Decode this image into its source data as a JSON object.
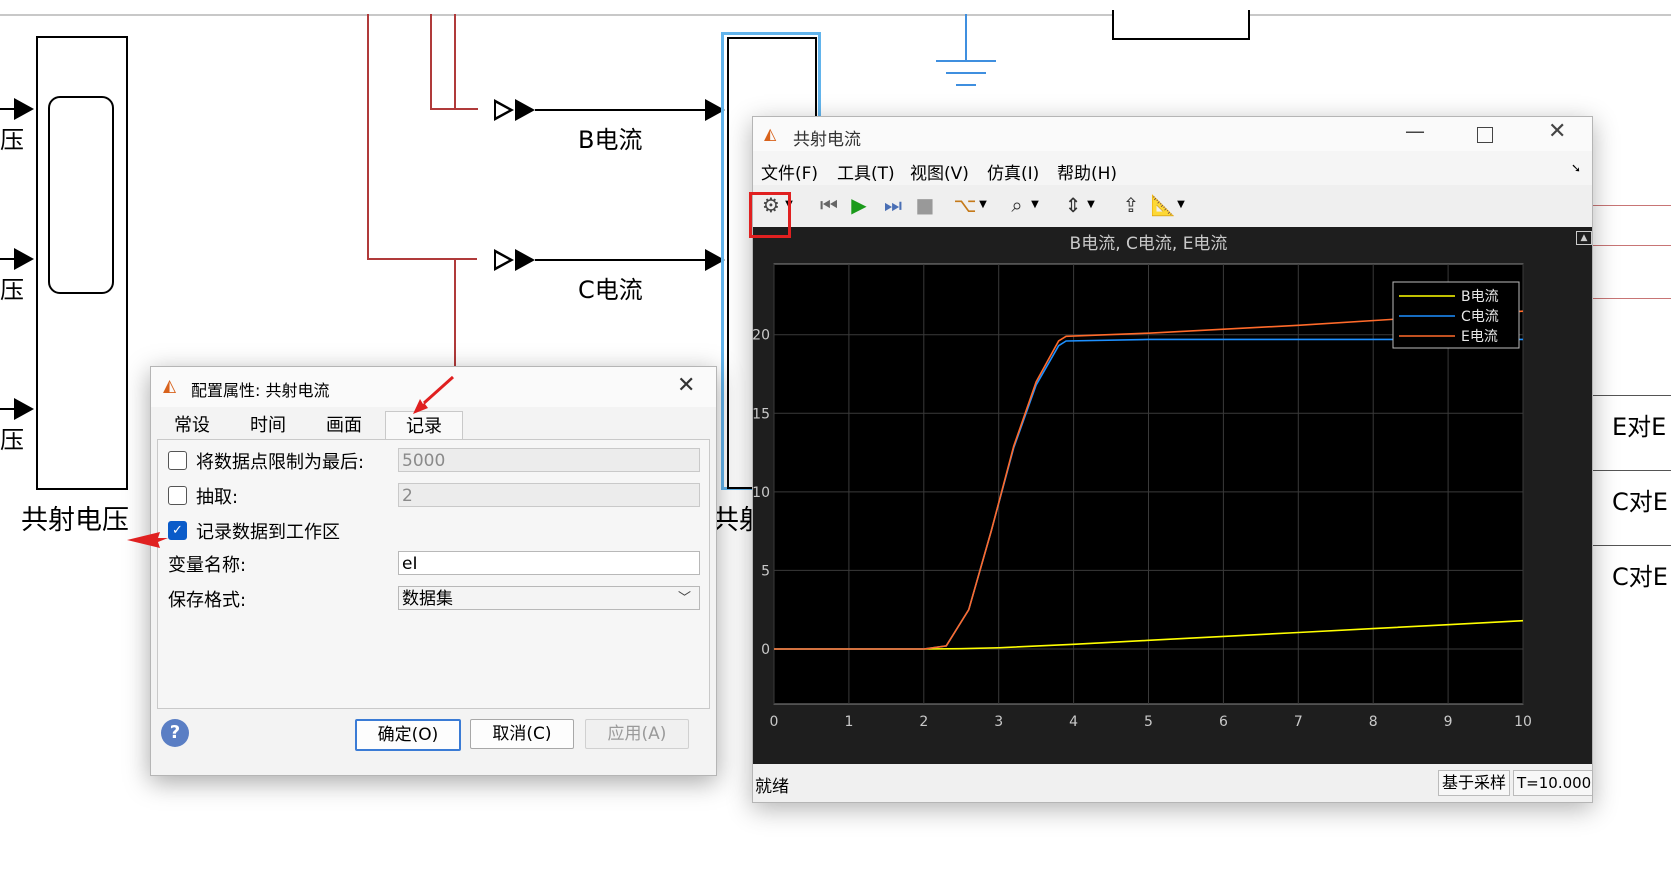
{
  "diagram": {
    "left_block_label": "共射电压",
    "left_port_labels": [
      "压",
      "压",
      "压"
    ],
    "signal_labels": [
      "B电流",
      "C电流"
    ],
    "middle_block_partial_label": "共射",
    "right_labels": [
      "E对E",
      "C对E",
      "C对E"
    ]
  },
  "dialog": {
    "title": "配置属性: 共射电流",
    "tabs": [
      "常设",
      "时间",
      "画面",
      "记录"
    ],
    "active_tab": "记录",
    "limit_points_label": "将数据点限制为最后:",
    "limit_points_value": "5000",
    "limit_points_checked": false,
    "decimation_label": "抽取:",
    "decimation_value": "2",
    "decimation_checked": false,
    "log_to_workspace_label": "记录数据到工作区",
    "log_to_workspace_checked": true,
    "variable_name_label": "变量名称:",
    "variable_name_value": "eI",
    "save_format_label": "保存格式:",
    "save_format_value": "数据集",
    "help_icon": "help-icon",
    "ok_label": "确定(O)",
    "cancel_label": "取消(C)",
    "apply_label": "应用(A)"
  },
  "scope": {
    "title": "共射电流",
    "menus": [
      "文件(F)",
      "工具(T)",
      "视图(V)",
      "仿真(I)",
      "帮助(H)"
    ],
    "toolbar_icons": [
      "gear-icon",
      "step-back-icon",
      "run-icon",
      "step-forward-icon",
      "stop-icon",
      "signal-select-icon",
      "zoom-icon",
      "fit-axes-icon",
      "trigger-icon",
      "measure-icon"
    ],
    "status_left": "就绪",
    "status_mode": "基于采样",
    "status_time": "T=10.000"
  },
  "chart_data": {
    "type": "line",
    "title": "B电流, C电流, E电流",
    "xlabel": "",
    "ylabel": "",
    "xlim": [
      0,
      10
    ],
    "ylim": [
      -3.5,
      24.5
    ],
    "xticks": [
      0,
      1,
      2,
      3,
      4,
      5,
      6,
      7,
      8,
      9,
      10
    ],
    "yticks": [
      0,
      5,
      10,
      15,
      20
    ],
    "grid": true,
    "legend_position": "top-right",
    "series": [
      {
        "name": "B电流",
        "color": "#ffff00",
        "x": [
          0,
          2,
          2.5,
          3,
          4,
          5,
          6,
          7,
          8,
          9,
          10
        ],
        "y": [
          0,
          0,
          0.02,
          0.08,
          0.3,
          0.55,
          0.8,
          1.05,
          1.3,
          1.55,
          1.8
        ]
      },
      {
        "name": "C电流",
        "color": "#1e90ff",
        "x": [
          0,
          2,
          2.3,
          2.6,
          2.9,
          3.2,
          3.5,
          3.8,
          3.9,
          5,
          7,
          10
        ],
        "y": [
          0,
          0,
          0.2,
          2.5,
          7.5,
          12.8,
          16.8,
          19.3,
          19.6,
          19.7,
          19.7,
          19.7
        ]
      },
      {
        "name": "E电流",
        "color": "#ff6a2a",
        "x": [
          0,
          2,
          2.3,
          2.6,
          2.9,
          3.2,
          3.5,
          3.8,
          3.9,
          5,
          7,
          10
        ],
        "y": [
          0,
          0,
          0.2,
          2.5,
          7.5,
          12.9,
          17.0,
          19.6,
          19.9,
          20.1,
          20.6,
          21.5
        ]
      }
    ]
  }
}
